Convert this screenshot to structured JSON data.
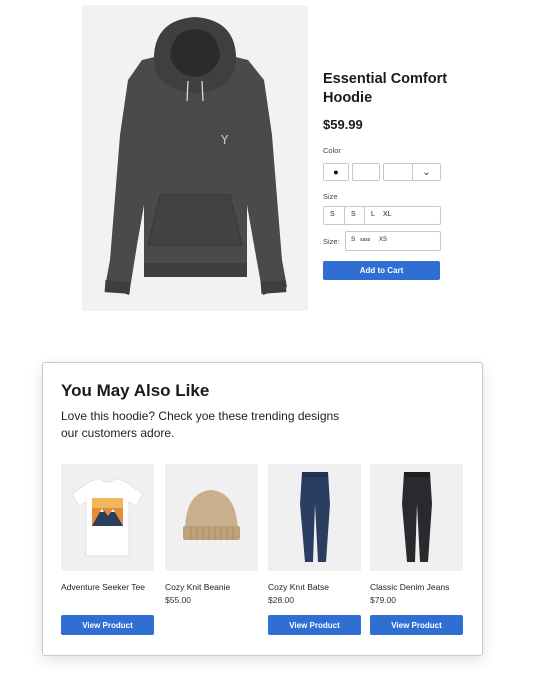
{
  "product": {
    "title_line1": "Essential Comfort",
    "title_line2": "Hoodie",
    "price": "$59.99",
    "color_label": "Color",
    "color_options": [
      "●",
      "",
      "",
      "⌄"
    ],
    "size_label": "Size",
    "sizes": [
      "S",
      "S",
      "L",
      "XL"
    ],
    "size_select_label": "Size:",
    "size_select_values": [
      "S",
      "sass",
      "XS"
    ],
    "add_to_cart": "Add to Cart"
  },
  "recommendations": {
    "title": "You May Also Like",
    "subtitle": "Love this hoodie? Check yoe these trending designs our customers adore.",
    "items": [
      {
        "name": "Adventure Seeker Tee",
        "price": "",
        "button": "View Product",
        "icon": "tshirt-icon"
      },
      {
        "name": "Cozy Knit Beanie",
        "price": "$55.00",
        "button": "",
        "icon": "beanie-icon"
      },
      {
        "name": "Cozy Knıt Batse",
        "price": "$28.00",
        "button": "View Product",
        "icon": "jeans-icon"
      },
      {
        "name": "Classic Denim Jeans",
        "price": "$79.00",
        "button": "View Product",
        "icon": "jeans-icon"
      }
    ]
  },
  "colors": {
    "accent": "#2f6fd4",
    "hoodie": "#4a4a4a",
    "blue_jeans": "#2b3e62",
    "black_jeans": "#2a2a2e",
    "beanie": "#c7b08b"
  }
}
